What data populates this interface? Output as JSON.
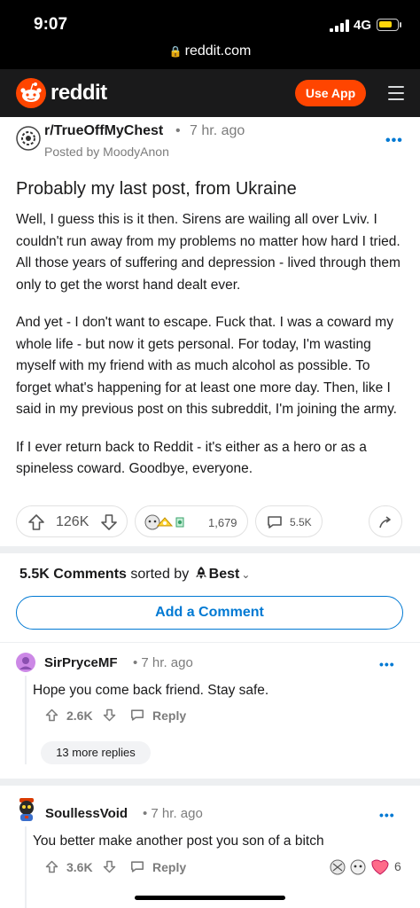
{
  "status_bar": {
    "time": "9:07",
    "network": "4G",
    "battery_level": 0.75,
    "url": "reddit.com"
  },
  "header": {
    "wordmark": "reddit",
    "use_app_label": "Use App",
    "accent_color": "#ff4500"
  },
  "post": {
    "subreddit": "r/TrueOffMyChest",
    "separator": "•",
    "time": "7 hr. ago",
    "posted_by": "Posted by MoodyAnon",
    "more": "•••",
    "title": "Probably my last post, from Ukraine",
    "paragraphs": [
      "Well, I guess this is it then. Sirens are wailing all over Lviv. I couldn't run away from my problems no matter how hard I tried. All those years of suffering and depression - lived through them only to get the worst hand dealt ever.",
      "And yet - I don't want to escape. Fuck that. I was a coward my whole life - but now it gets personal. For today, I'm wasting myself with my friend with as much alcohol as possible. To forget what's happening for at least one more day. Then, like I said in my previous post on this subreddit, I'm joining the army.",
      "If I ever return back to Reddit - it's either as a hero or as a spineless coward. Goodbye, everyone."
    ],
    "votes": "126K",
    "awards_count": "1,679",
    "comments_count": "5.5K"
  },
  "comments_section": {
    "count_label": "5.5K Comments",
    "sorted_by": "sorted by",
    "sort_value": "Best",
    "add_comment_label": "Add a Comment"
  },
  "comments": [
    {
      "user": "SirPryceMF",
      "time": "• 7 hr. ago",
      "body": "Hope you come back friend. Stay safe.",
      "votes": "2.6K",
      "reply_label": "Reply",
      "more_replies": "13 more replies",
      "avatar_color": "#cc88e6"
    },
    {
      "user": "SoullessVoid",
      "time": "• 7 hr. ago",
      "body": "You better make another post you son of a bitch",
      "votes": "3.6K",
      "reply_label": "Reply",
      "awards_count": "6"
    }
  ],
  "icons": {
    "lock": "lock-icon",
    "upvote": "upvote-icon",
    "downvote": "downvote-icon",
    "comment": "comment-bubble-icon",
    "share": "share-icon",
    "menu": "hamburger-menu-icon",
    "sort": "rocket-icon"
  }
}
